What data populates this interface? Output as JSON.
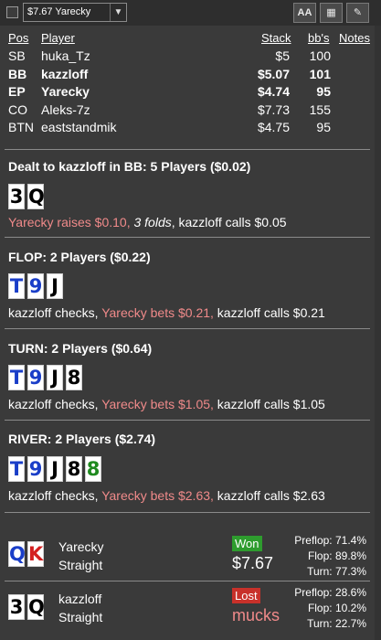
{
  "toolbar": {
    "select_value": "$7.67 Yarecky",
    "dropdown_arrow": "▼",
    "btn_font": "AA",
    "btn_grid": "▦",
    "btn_edit": "✎"
  },
  "players": {
    "headers": {
      "pos": "Pos",
      "player": "Player",
      "stack": "Stack",
      "bbs": "bb's",
      "notes": "Notes"
    },
    "rows": [
      {
        "pos": "SB",
        "player": "huka_Tz",
        "stack": "$5",
        "bbs": "100",
        "bold": false
      },
      {
        "pos": "BB",
        "player": "kazzloff",
        "stack": "$5.07",
        "bbs": "101",
        "bold": true
      },
      {
        "pos": "EP",
        "player": "Yarecky",
        "stack": "$4.74",
        "bbs": "95",
        "bold": true
      },
      {
        "pos": "CO",
        "player": "Aleks-7z",
        "stack": "$7.73",
        "bbs": "155",
        "bold": false
      },
      {
        "pos": "BTN",
        "player": "eaststandmik",
        "stack": "$4.75",
        "bbs": "95",
        "bold": false
      }
    ]
  },
  "preflop": {
    "title": "Dealt to kazzloff in BB: 5 Players ($0.02)",
    "cards": [
      {
        "rank": "3",
        "color": "#000000"
      },
      {
        "rank": "Q",
        "color": "#000000"
      }
    ],
    "action_1": "Yarecky raises $0.10,",
    "action_2": "3 folds",
    "action_3": ", kazzloff calls $0.05"
  },
  "flop": {
    "title": "FLOP: 2 Players ($0.22)",
    "cards": [
      {
        "rank": "T",
        "color": "#1a3ec8"
      },
      {
        "rank": "9",
        "color": "#1a3ec8"
      },
      {
        "rank": "J",
        "color": "#000000"
      }
    ],
    "action_1": "kazzloff checks,",
    "action_2": "Yarecky bets $0.21,",
    "action_3": "kazzloff calls $0.21"
  },
  "turn": {
    "title": "TURN: 2 Players ($0.64)",
    "cards": [
      {
        "rank": "T",
        "color": "#1a3ec8"
      },
      {
        "rank": "9",
        "color": "#1a3ec8"
      },
      {
        "rank": "J",
        "color": "#000000"
      },
      {
        "rank": "8",
        "color": "#000000"
      }
    ],
    "action_1": "kazzloff checks,",
    "action_2": "Yarecky bets $1.05,",
    "action_3": "kazzloff calls $1.05"
  },
  "river": {
    "title": "RIVER: 2 Players ($2.74)",
    "cards": [
      {
        "rank": "T",
        "color": "#1a3ec8"
      },
      {
        "rank": "9",
        "color": "#1a3ec8"
      },
      {
        "rank": "J",
        "color": "#000000"
      },
      {
        "rank": "8",
        "color": "#000000"
      },
      {
        "rank": "8",
        "color": "#1f8a1f"
      }
    ],
    "action_1": "kazzloff checks,",
    "action_2": "Yarecky bets $2.63,",
    "action_3": "kazzloff calls $2.63"
  },
  "results": [
    {
      "cards": [
        {
          "rank": "Q",
          "color": "#1a3ec8"
        },
        {
          "rank": "K",
          "color": "#d42020"
        }
      ],
      "player": "Yarecky",
      "hand": "Straight",
      "badge": "Won",
      "amount": "$7.67",
      "stats": [
        {
          "label": "Preflop:",
          "value": "71.4%"
        },
        {
          "label": "Flop:",
          "value": "89.8%"
        },
        {
          "label": "Turn:",
          "value": "77.3%"
        }
      ]
    },
    {
      "cards": [
        {
          "rank": "3",
          "color": "#000000"
        },
        {
          "rank": "Q",
          "color": "#000000"
        }
      ],
      "player": "kazzloff",
      "hand": "Straight",
      "badge": "Lost",
      "amount": "mucks",
      "stats": [
        {
          "label": "Preflop:",
          "value": "28.6%"
        },
        {
          "label": "Flop:",
          "value": "10.2%"
        },
        {
          "label": "Turn:",
          "value": "22.7%"
        }
      ]
    }
  ]
}
